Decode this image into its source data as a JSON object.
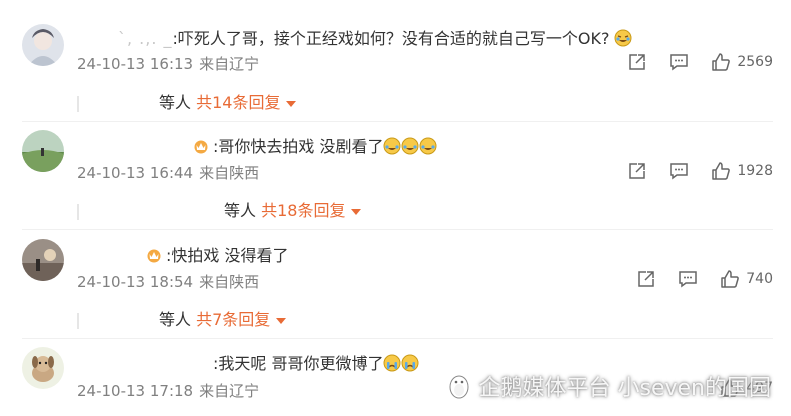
{
  "comments": [
    {
      "user_masked": "`, .,. _",
      "text": ":吓死人了哥，接个正经戏如何？没有合适的就自己写一个OK?",
      "time": "24-10-13 16:13",
      "location": "来自辽宁",
      "likes": "2569",
      "replies_prefix": "等人",
      "replies_label": "共14条回复"
    },
    {
      "user_masked": "",
      "text": ":哥你快去拍戏 没剧看了",
      "time": "24-10-13 16:44",
      "location": "来自陕西",
      "likes": "1928",
      "replies_prefix": "等人",
      "replies_label": "共18条回复"
    },
    {
      "user_masked": "",
      "text": ":快拍戏 没得看了",
      "time": "24-10-13 18:54",
      "location": "来自陕西",
      "likes": "740",
      "replies_prefix": "等人",
      "replies_label": "共7条回复"
    },
    {
      "user_masked": "",
      "text": ":我天呢 哥哥你更微博了",
      "time": "24-10-13 17:18",
      "location": "来自辽宁",
      "likes": "497"
    }
  ],
  "watermark": "企鹅媒体平台 小seven的国园",
  "colors": {
    "accent": "#e86b36",
    "meta": "#808080"
  }
}
